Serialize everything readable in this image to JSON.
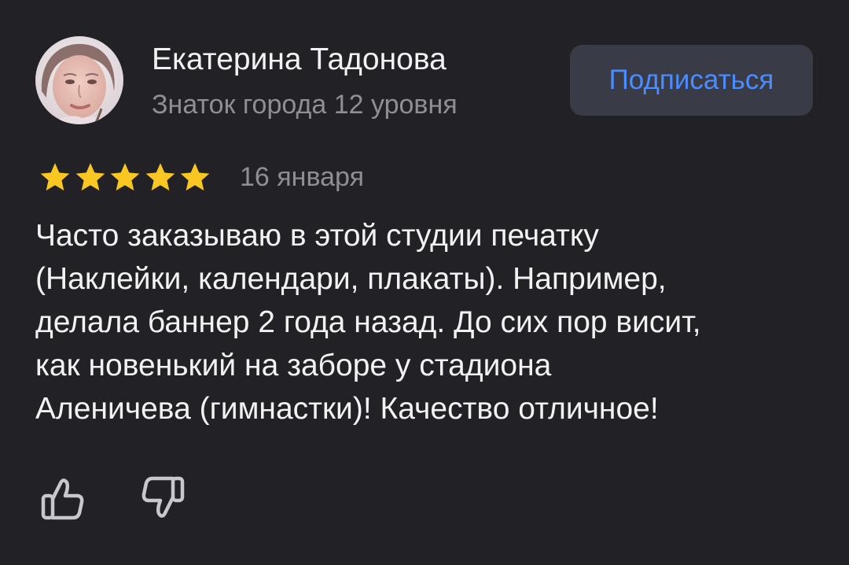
{
  "author": {
    "name": "Екатерина Тадонова",
    "level": "Знаток города 12 уровня",
    "avatar_icon": "user-avatar-photo"
  },
  "subscribe_button": {
    "label": "Подписаться"
  },
  "review": {
    "rating": 5,
    "rating_max": 5,
    "date": "16 января",
    "text_lines": [
      "Часто заказываю в этой студии печатку",
      "(Наклейки, календари, плакаты). Например,",
      "делала баннер 2 года назад. До сих пор висит,",
      "как новенький на заборе у стадиона",
      "Аленичева (гимнастки)! Качество отличное!"
    ]
  },
  "actions": {
    "like_icon": "thumbs-up-icon",
    "dislike_icon": "thumbs-down-icon"
  },
  "colors": {
    "background": "#222226",
    "star": "#f9c724",
    "button_bg": "#393b46",
    "button_text": "#4b8cff",
    "secondary_text": "#8e8e93",
    "primary_text": "#f2f2f2"
  }
}
